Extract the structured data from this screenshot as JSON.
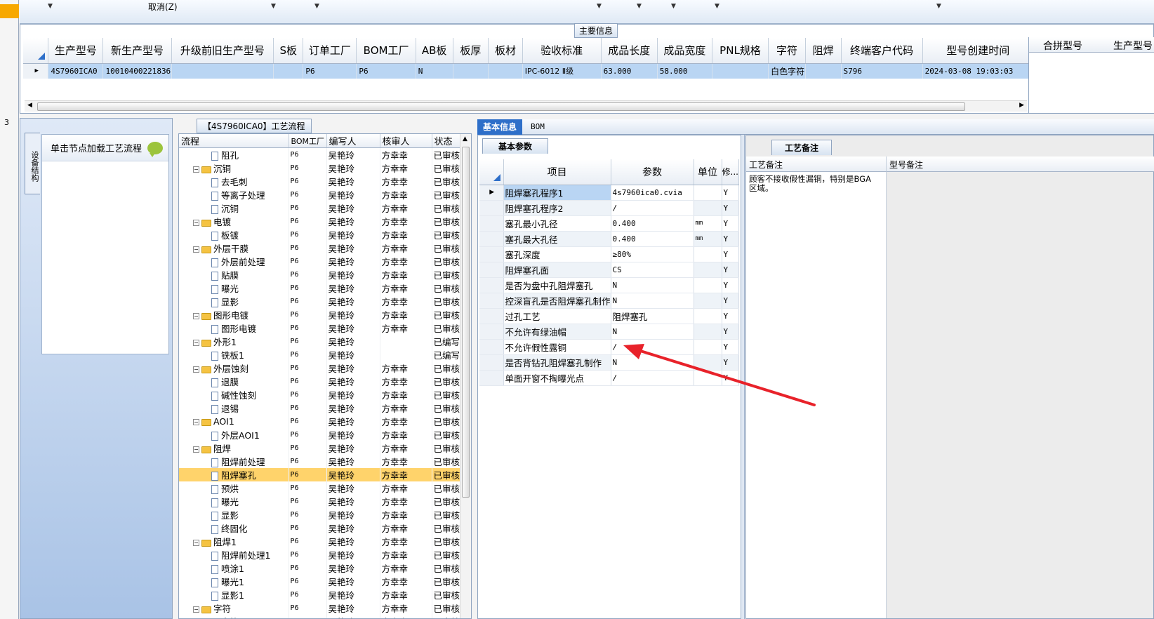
{
  "left_strip": {
    "number": "3"
  },
  "toolbar": {
    "cancel_label": "取消(Z)"
  },
  "main_info": {
    "group_title": "主要信息",
    "columns": [
      "生产型号",
      "新生产型号",
      "升级前旧生产型号",
      "S板",
      "订单工厂",
      "BOM工厂",
      "AB板",
      "板厚",
      "板材",
      "验收标准",
      "成品长度",
      "成品宽度",
      "PNL规格",
      "字符",
      "阻焊",
      "终端客户代码",
      "型号创建时间"
    ],
    "row": [
      "4S7960ICA0",
      "10010400221836",
      "",
      "",
      "P6",
      "P6",
      "N",
      "",
      "",
      "IPC-6012 Ⅱ级",
      "63.000",
      "58.000",
      "",
      "白色字符",
      "",
      "S796",
      "2024-03-08 19:03:03"
    ],
    "right_columns": [
      "合拼型号",
      "生产型号"
    ]
  },
  "left_pane": {
    "vertical_tab": "设备结构",
    "node_hint": "单击节点加载工艺流程"
  },
  "process": {
    "title": "【4S7960ICA0】工艺流程",
    "columns": [
      "流程",
      "BOM工厂",
      "编写人",
      "核审人",
      "状态"
    ],
    "rows": [
      {
        "level": 2,
        "name": "阻孔",
        "bom": "P6",
        "writer": "吴艳玲",
        "reviewer": "方幸幸",
        "status": "已审核"
      },
      {
        "level": 1,
        "name": "沉铜",
        "bom": "P6",
        "writer": "吴艳玲",
        "reviewer": "方幸幸",
        "status": "已审核"
      },
      {
        "level": 2,
        "name": "去毛刺",
        "bom": "P6",
        "writer": "吴艳玲",
        "reviewer": "方幸幸",
        "status": "已审核"
      },
      {
        "level": 2,
        "name": "等离子处理",
        "bom": "P6",
        "writer": "吴艳玲",
        "reviewer": "方幸幸",
        "status": "已审核"
      },
      {
        "level": 2,
        "name": "沉铜",
        "bom": "P6",
        "writer": "吴艳玲",
        "reviewer": "方幸幸",
        "status": "已审核"
      },
      {
        "level": 1,
        "name": "电镀",
        "bom": "P6",
        "writer": "吴艳玲",
        "reviewer": "方幸幸",
        "status": "已审核"
      },
      {
        "level": 2,
        "name": "板镀",
        "bom": "P6",
        "writer": "吴艳玲",
        "reviewer": "方幸幸",
        "status": "已审核"
      },
      {
        "level": 1,
        "name": "外层干膜",
        "bom": "P6",
        "writer": "吴艳玲",
        "reviewer": "方幸幸",
        "status": "已审核"
      },
      {
        "level": 2,
        "name": "外层前处理",
        "bom": "P6",
        "writer": "吴艳玲",
        "reviewer": "方幸幸",
        "status": "已审核"
      },
      {
        "level": 2,
        "name": "贴膜",
        "bom": "P6",
        "writer": "吴艳玲",
        "reviewer": "方幸幸",
        "status": "已审核"
      },
      {
        "level": 2,
        "name": "曝光",
        "bom": "P6",
        "writer": "吴艳玲",
        "reviewer": "方幸幸",
        "status": "已审核"
      },
      {
        "level": 2,
        "name": "显影",
        "bom": "P6",
        "writer": "吴艳玲",
        "reviewer": "方幸幸",
        "status": "已审核"
      },
      {
        "level": 1,
        "name": "图形电镀",
        "bom": "P6",
        "writer": "吴艳玲",
        "reviewer": "方幸幸",
        "status": "已审核"
      },
      {
        "level": 2,
        "name": "图形电镀",
        "bom": "P6",
        "writer": "吴艳玲",
        "reviewer": "方幸幸",
        "status": "已审核"
      },
      {
        "level": 1,
        "name": "外形1",
        "bom": "P6",
        "writer": "吴艳玲",
        "reviewer": "",
        "status": "已编写"
      },
      {
        "level": 2,
        "name": "铣板1",
        "bom": "P6",
        "writer": "吴艳玲",
        "reviewer": "",
        "status": "已编写"
      },
      {
        "level": 1,
        "name": "外层蚀刻",
        "bom": "P6",
        "writer": "吴艳玲",
        "reviewer": "方幸幸",
        "status": "已审核"
      },
      {
        "level": 2,
        "name": "退膜",
        "bom": "P6",
        "writer": "吴艳玲",
        "reviewer": "方幸幸",
        "status": "已审核"
      },
      {
        "level": 2,
        "name": "碱性蚀刻",
        "bom": "P6",
        "writer": "吴艳玲",
        "reviewer": "方幸幸",
        "status": "已审核"
      },
      {
        "level": 2,
        "name": "退锡",
        "bom": "P6",
        "writer": "吴艳玲",
        "reviewer": "方幸幸",
        "status": "已审核"
      },
      {
        "level": 1,
        "name": "AOI1",
        "bom": "P6",
        "writer": "吴艳玲",
        "reviewer": "方幸幸",
        "status": "已审核"
      },
      {
        "level": 2,
        "name": "外层AOI1",
        "bom": "P6",
        "writer": "吴艳玲",
        "reviewer": "方幸幸",
        "status": "已审核"
      },
      {
        "level": 1,
        "name": "阻焊",
        "bom": "P6",
        "writer": "吴艳玲",
        "reviewer": "方幸幸",
        "status": "已审核"
      },
      {
        "level": 2,
        "name": "阻焊前处理",
        "bom": "P6",
        "writer": "吴艳玲",
        "reviewer": "方幸幸",
        "status": "已审核"
      },
      {
        "level": 2,
        "name": "阻焊塞孔",
        "bom": "P6",
        "writer": "吴艳玲",
        "reviewer": "方幸幸",
        "status": "已审核",
        "selected": true
      },
      {
        "level": 2,
        "name": "预烘",
        "bom": "P6",
        "writer": "吴艳玲",
        "reviewer": "方幸幸",
        "status": "已审核"
      },
      {
        "level": 2,
        "name": "曝光",
        "bom": "P6",
        "writer": "吴艳玲",
        "reviewer": "方幸幸",
        "status": "已审核"
      },
      {
        "level": 2,
        "name": "显影",
        "bom": "P6",
        "writer": "吴艳玲",
        "reviewer": "方幸幸",
        "status": "已审核"
      },
      {
        "level": 2,
        "name": "终固化",
        "bom": "P6",
        "writer": "吴艳玲",
        "reviewer": "方幸幸",
        "status": "已审核"
      },
      {
        "level": 1,
        "name": "阻焊1",
        "bom": "P6",
        "writer": "吴艳玲",
        "reviewer": "方幸幸",
        "status": "已审核"
      },
      {
        "level": 2,
        "name": "阻焊前处理1",
        "bom": "P6",
        "writer": "吴艳玲",
        "reviewer": "方幸幸",
        "status": "已审核"
      },
      {
        "level": 2,
        "name": "喷涂1",
        "bom": "P6",
        "writer": "吴艳玲",
        "reviewer": "方幸幸",
        "status": "已审核"
      },
      {
        "level": 2,
        "name": "曝光1",
        "bom": "P6",
        "writer": "吴艳玲",
        "reviewer": "方幸幸",
        "status": "已审核"
      },
      {
        "level": 2,
        "name": "显影1",
        "bom": "P6",
        "writer": "吴艳玲",
        "reviewer": "方幸幸",
        "status": "已审核"
      },
      {
        "level": 1,
        "name": "字符",
        "bom": "P6",
        "writer": "吴艳玲",
        "reviewer": "方幸幸",
        "status": "已审核"
      },
      {
        "level": 2,
        "name": "字符",
        "bom": "P6",
        "writer": "吴艳玲",
        "reviewer": "方幸幸",
        "status": "已审核"
      }
    ]
  },
  "tabs": {
    "active": "基本信息",
    "other": "BOM"
  },
  "basic": {
    "subtab": "基本参数",
    "columns": [
      "项目",
      "参数",
      "单位",
      "修..."
    ],
    "rows": [
      {
        "item": "阻焊塞孔程序1",
        "param": "4s7960ica0.cvia",
        "unit": "",
        "flag": "Y"
      },
      {
        "item": "阻焊塞孔程序2",
        "param": "/",
        "unit": "",
        "flag": "Y"
      },
      {
        "item": "塞孔最小孔径",
        "param": "0.400",
        "unit": "mm",
        "flag": "Y"
      },
      {
        "item": "塞孔最大孔径",
        "param": "0.400",
        "unit": "mm",
        "flag": "Y"
      },
      {
        "item": "塞孔深度",
        "param": "≥80%",
        "unit": "",
        "flag": "Y"
      },
      {
        "item": "阻焊塞孔面",
        "param": "CS",
        "unit": "",
        "flag": "Y"
      },
      {
        "item": "是否为盘中孔阻焊塞孔",
        "param": "N",
        "unit": "",
        "flag": "Y"
      },
      {
        "item": "控深盲孔是否阻焊塞孔制作",
        "param": "N",
        "unit": "",
        "flag": "Y"
      },
      {
        "item": "过孔工艺",
        "param": "阻焊塞孔",
        "unit": "",
        "flag": "Y"
      },
      {
        "item": "不允许有绿油帽",
        "param": "N",
        "unit": "",
        "flag": "Y"
      },
      {
        "item": "不允许假性露铜",
        "param": "/",
        "unit": "",
        "flag": "Y"
      },
      {
        "item": "是否背钻孔阻焊塞孔制作",
        "param": "N",
        "unit": "",
        "flag": "Y"
      },
      {
        "item": "单面开窗不掏曝光点",
        "param": "/",
        "unit": "",
        "flag": "Y"
      }
    ]
  },
  "notes": {
    "tab": "工艺备注",
    "col1": "工艺备注",
    "col2": "型号备注",
    "text": "顾客不接收假性漏铜，特别是BGA区域。"
  },
  "colors": {
    "accent": "#2e6fc9",
    "selection": "#ffd36b",
    "row_highlight": "#b9d5f3",
    "arrow": "#e8222a"
  }
}
